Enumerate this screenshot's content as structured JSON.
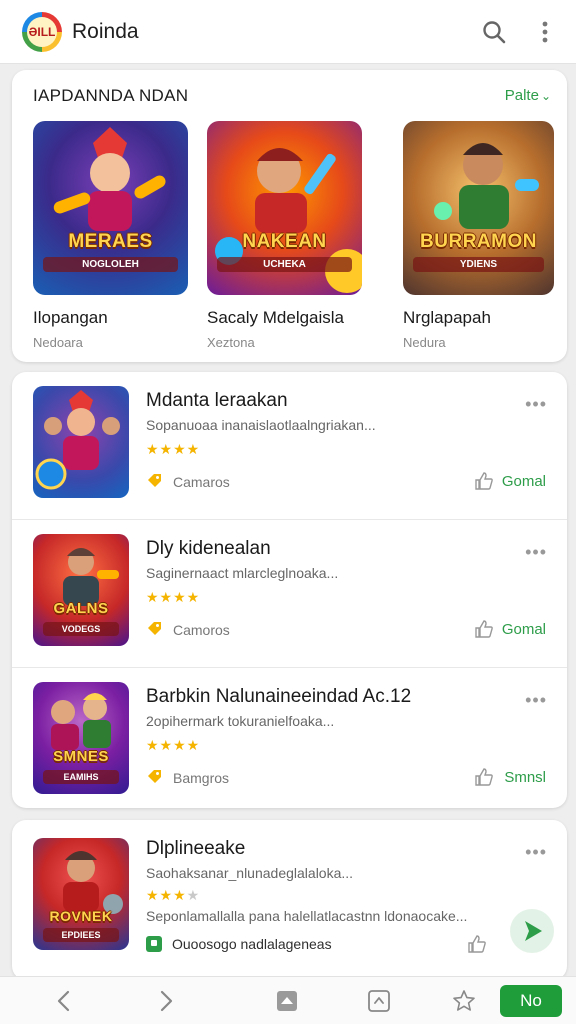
{
  "app": {
    "logo_text": "ƏILL",
    "title": "Roinda"
  },
  "topbar": {
    "search_icon": "search-icon",
    "menu_icon": "more-vert-icon"
  },
  "featured": {
    "title": "IAPDANNDA NDAN",
    "link_label": "Palte",
    "items": [
      {
        "name": "Ilopangan",
        "sub": "Nedoara",
        "art_title": "MERAES",
        "art_sub": "NOGLOLEH"
      },
      {
        "name": "Sacaly Mdelgaisla",
        "sub": "Xeztona",
        "art_title": "NAKEAN",
        "art_sub": "UCHEKA"
      },
      {
        "name": "Nrglapapah",
        "sub": "Nedura",
        "art_title": "BURRAMON",
        "art_sub": "YDIENS"
      }
    ]
  },
  "list": {
    "items": [
      {
        "title": "Mdanta leraakan",
        "desc": "Sopanuoaa inanaislaotlaalngriakan...",
        "stars": 4,
        "max_stars": 4,
        "tag": "Camaros",
        "action": "Gomal",
        "art_title": "",
        "art_sub": ""
      },
      {
        "title": "Dly kidenealan",
        "desc": "Saginernaact mlarcleglnoaka...",
        "stars": 4,
        "max_stars": 4,
        "tag": "Camoros",
        "action": "Gomal",
        "art_title": "GALNS",
        "art_sub": "VODEGS"
      },
      {
        "title": "Barbkin Nalunaineeindad Ac.12",
        "desc": "2opihermark tokuranielfoaka...",
        "stars": 4,
        "max_stars": 4,
        "tag": "Bamgros",
        "action": "Smnsl",
        "art_title": "SMNES",
        "art_sub": "EAMIHS"
      }
    ]
  },
  "last_item": {
    "title": "Dlplineeake",
    "desc": "Saohaksanar_nlunadeglalaloka...",
    "stars": 3,
    "max_stars": 4,
    "desc2": "Seponlamallalla pana halellatlacastnn ldonaocake...",
    "note": "Ouoosogo nadlalageneas",
    "art_title": "ROVNEK",
    "art_sub": "EPDIEES"
  },
  "bottombar": {
    "primary_label": "No"
  },
  "colors": {
    "accent": "#2e9d4a",
    "primary_button": "#1f9d3b",
    "star": "#f4b400"
  }
}
